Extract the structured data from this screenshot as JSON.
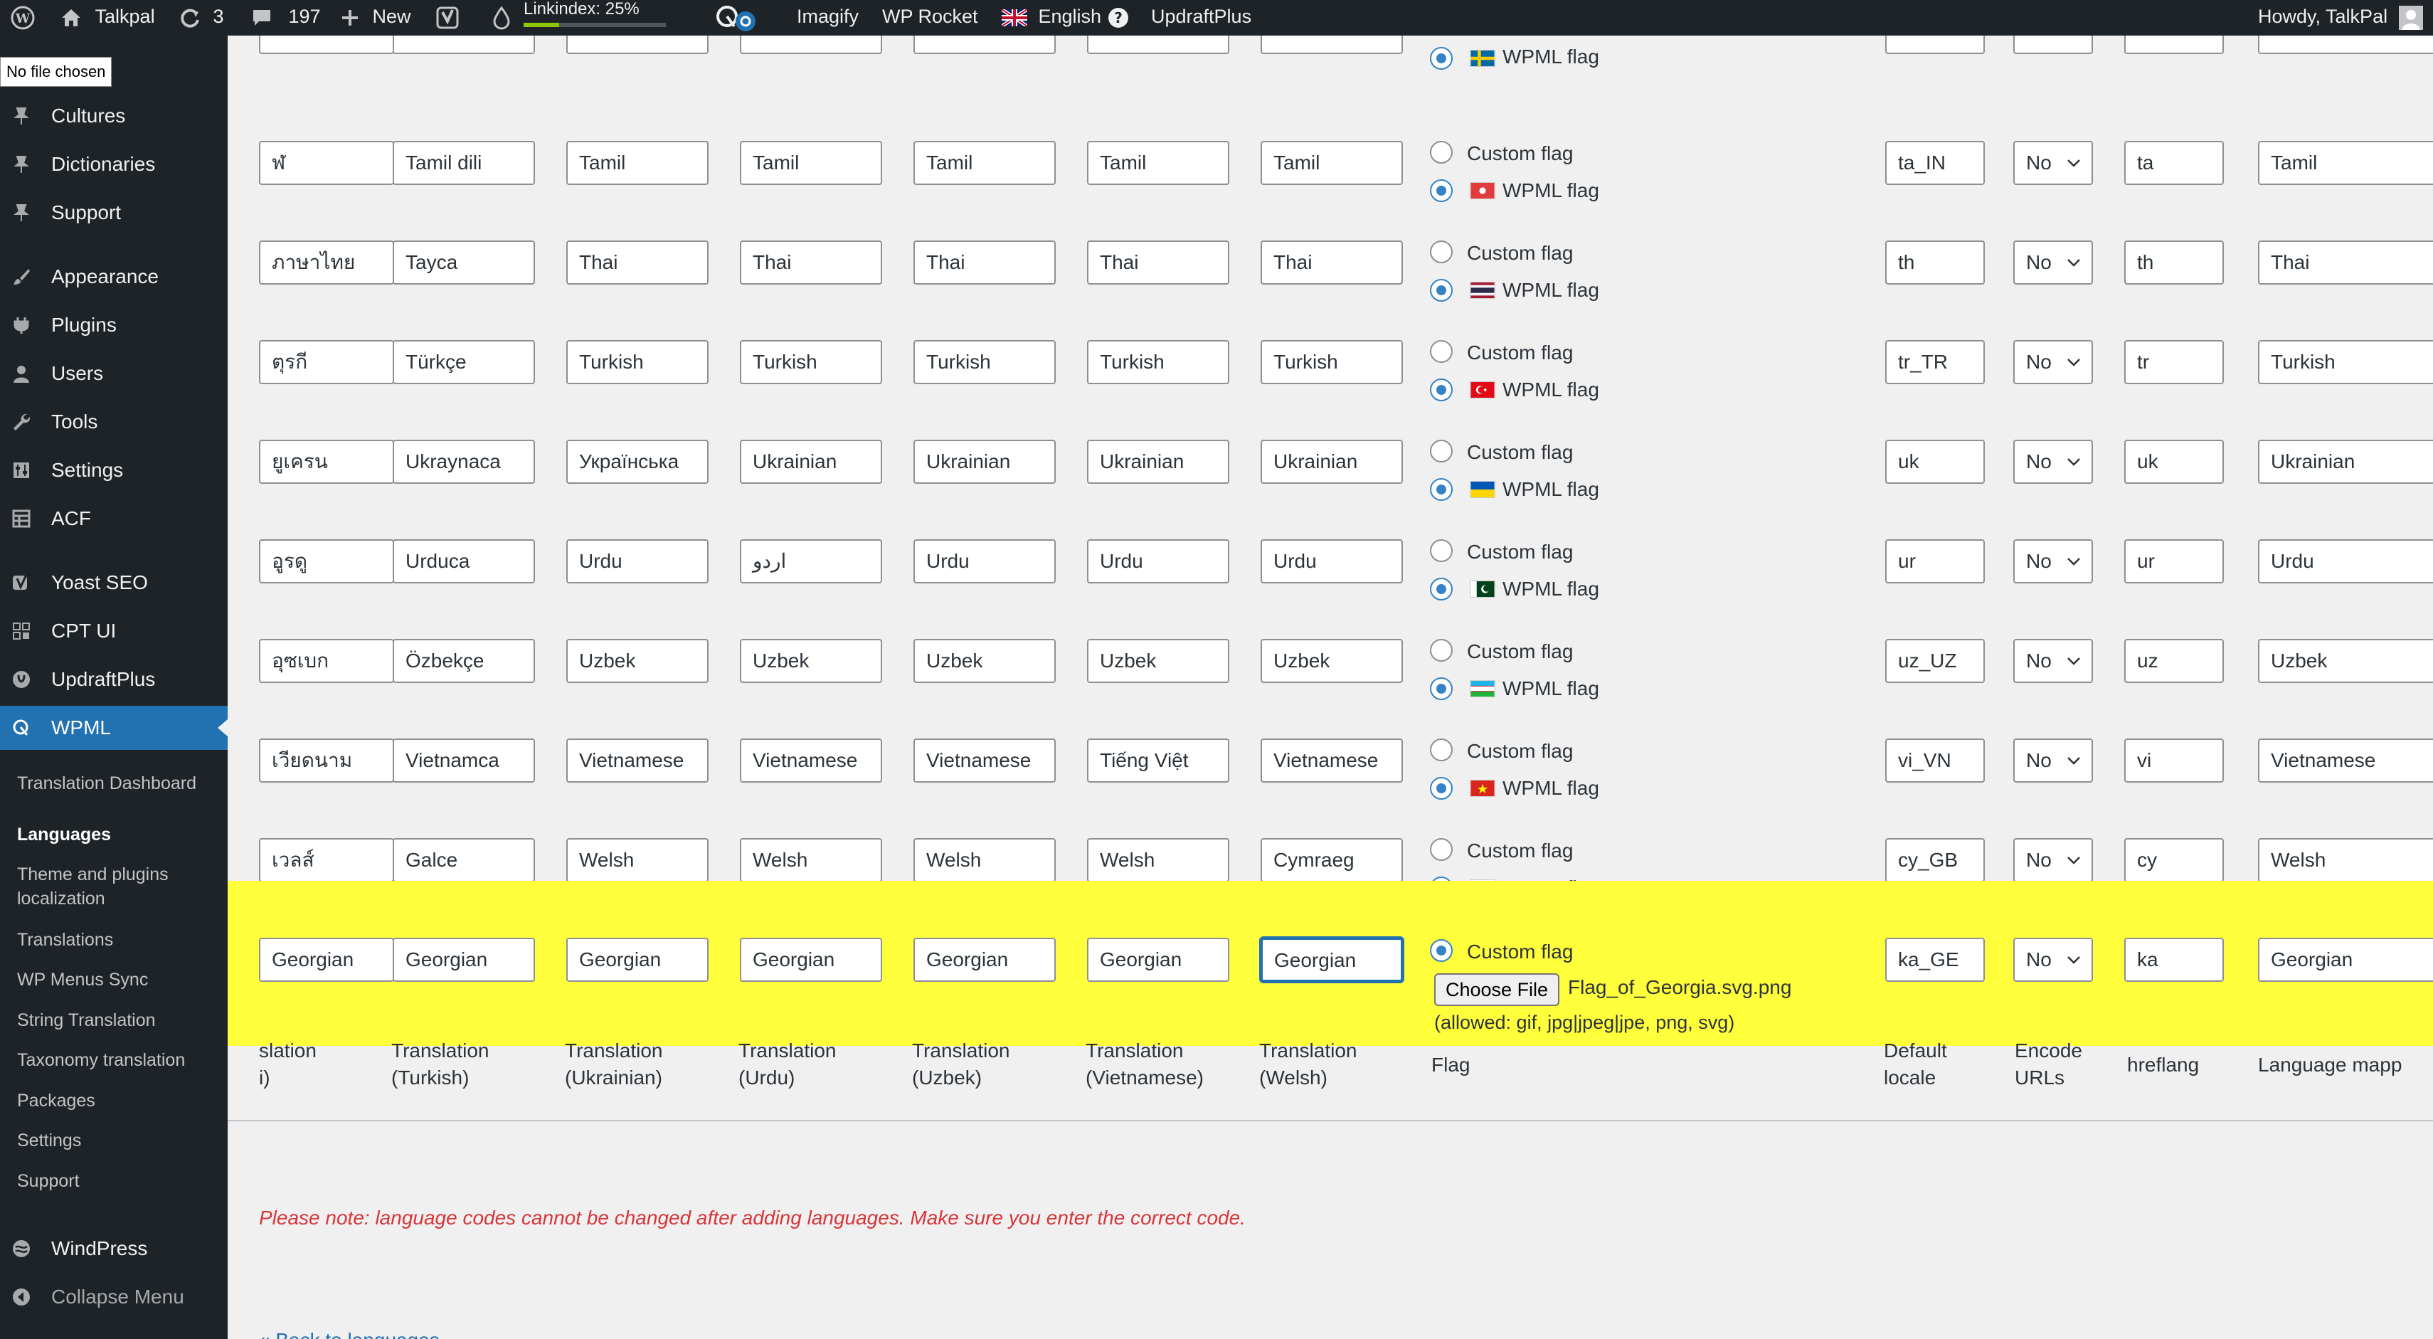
{
  "admin_bar": {
    "site_name": "Talkpal",
    "updates_count": "3",
    "comments_count": "197",
    "new_label": "New",
    "linkindex_label": "Linkindex: 25%",
    "linkindex_progress": 0.25,
    "imagify_label": "Imagify",
    "wp_rocket_label": "WP Rocket",
    "language_label": "English",
    "updraftplus_label": "UpdraftPlus",
    "howdy_label": "Howdy, TalkPal"
  },
  "tooltip": "No file chosen",
  "sidebar": {
    "items": [
      {
        "label": "Cultures",
        "icon": "pin-icon"
      },
      {
        "label": "Dictionaries",
        "icon": "pin-icon"
      },
      {
        "label": "Support",
        "icon": "pin-icon"
      },
      {
        "label": "Appearance",
        "icon": "brush-icon"
      },
      {
        "label": "Plugins",
        "icon": "plug-icon"
      },
      {
        "label": "Users",
        "icon": "user-icon"
      },
      {
        "label": "Tools",
        "icon": "wrench-icon"
      },
      {
        "label": "Settings",
        "icon": "sliders-icon"
      },
      {
        "label": "ACF",
        "icon": "grid-icon"
      },
      {
        "label": "Yoast SEO",
        "icon": "yoast-icon"
      },
      {
        "label": "CPT UI",
        "icon": "grid-icon"
      },
      {
        "label": "UpdraftPlus",
        "icon": "updraft-icon"
      },
      {
        "label": "WPML",
        "icon": "wpml-icon"
      }
    ],
    "submenu": [
      {
        "label": "Translation Dashboard"
      },
      {
        "label": "Languages"
      },
      {
        "label": "Theme and plugins localization"
      },
      {
        "label": "Translations"
      },
      {
        "label": "WP Menus Sync"
      },
      {
        "label": "String Translation"
      },
      {
        "label": "Taxonomy translation"
      },
      {
        "label": "Packages"
      },
      {
        "label": "Settings"
      },
      {
        "label": "Support"
      }
    ],
    "bottom_items": [
      {
        "label": "WindPress",
        "icon": "windpress-icon"
      },
      {
        "label": "Collapse Menu",
        "icon": "collapse-icon"
      }
    ]
  },
  "languages": {
    "top_partial_flag_label": "WPML flag",
    "rows": [
      {
        "c0": "ฬ",
        "c1": "Tamil dili",
        "c2": "Tamil",
        "c3": "Tamil",
        "c4": "Tamil",
        "c5": "Tamil",
        "c6": "Tamil",
        "custom_flag": "Custom flag",
        "wpml_flag": "WPML flag",
        "locale": "ta_IN",
        "encode": "No",
        "hreflang": "ta",
        "mapping": "Tamil"
      },
      {
        "c0": "ภาษาไทย",
        "c1": "Tayca",
        "c2": "Thai",
        "c3": "Thai",
        "c4": "Thai",
        "c5": "Thai",
        "c6": "Thai",
        "custom_flag": "Custom flag",
        "wpml_flag": "WPML flag",
        "locale": "th",
        "encode": "No",
        "hreflang": "th",
        "mapping": "Thai"
      },
      {
        "c0": "ตุรกี",
        "c1": "Türkçe",
        "c2": "Turkish",
        "c3": "Turkish",
        "c4": "Turkish",
        "c5": "Turkish",
        "c6": "Turkish",
        "custom_flag": "Custom flag",
        "wpml_flag": "WPML flag",
        "locale": "tr_TR",
        "encode": "No",
        "hreflang": "tr",
        "mapping": "Turkish"
      },
      {
        "c0": "ยูเครน",
        "c1": "Ukraynaca",
        "c2": "Українська",
        "c3": "Ukrainian",
        "c4": "Ukrainian",
        "c5": "Ukrainian",
        "c6": "Ukrainian",
        "custom_flag": "Custom flag",
        "wpml_flag": "WPML flag",
        "locale": "uk",
        "encode": "No",
        "hreflang": "uk",
        "mapping": "Ukrainian"
      },
      {
        "c0": "อูรดู",
        "c1": "Urduca",
        "c2": "Urdu",
        "c3": "اردو",
        "c4": "Urdu",
        "c5": "Urdu",
        "c6": "Urdu",
        "custom_flag": "Custom flag",
        "wpml_flag": "WPML flag",
        "locale": "ur",
        "encode": "No",
        "hreflang": "ur",
        "mapping": "Urdu"
      },
      {
        "c0": "อุซเบก",
        "c1": "Özbekçe",
        "c2": "Uzbek",
        "c3": "Uzbek",
        "c4": "Uzbek",
        "c5": "Uzbek",
        "c6": "Uzbek",
        "custom_flag": "Custom flag",
        "wpml_flag": "WPML flag",
        "locale": "uz_UZ",
        "encode": "No",
        "hreflang": "uz",
        "mapping": "Uzbek"
      },
      {
        "c0": "เวียดนาม",
        "c1": "Vietnamca",
        "c2": "Vietnamese",
        "c3": "Vietnamese",
        "c4": "Vietnamese",
        "c5": "Tiếng Việt",
        "c6": "Vietnamese",
        "custom_flag": "Custom flag",
        "wpml_flag": "WPML flag",
        "locale": "vi_VN",
        "encode": "No",
        "hreflang": "vi",
        "mapping": "Vietnamese"
      },
      {
        "c0": "เวลส์",
        "c1": "Galce",
        "c2": "Welsh",
        "c3": "Welsh",
        "c4": "Welsh",
        "c5": "Welsh",
        "c6": "Cymraeg",
        "custom_flag": "Custom flag",
        "wpml_flag": "WPML flag",
        "locale": "cy_GB",
        "encode": "No",
        "hreflang": "cy",
        "mapping": "Welsh"
      }
    ],
    "new_row": {
      "c0": "Georgian",
      "c1": "Georgian",
      "c2": "Georgian",
      "c3": "Georgian",
      "c4": "Georgian",
      "c5": "Georgian",
      "c6": "Georgian",
      "custom_flag": "Custom flag",
      "choose_file": "Choose File",
      "file_name": "Flag_of_Georgia.svg.png",
      "allowed": "(allowed: gif, jpg|jpeg|jpe, png, svg)",
      "locale": "ka_GE",
      "encode": "No",
      "hreflang": "ka",
      "mapping": "Georgian"
    },
    "headers": {
      "c0a": "slation",
      "c0b": "i)",
      "c1a": "Translation",
      "c1b": "(Turkish)",
      "c2a": "Translation",
      "c2b": "(Ukrainian)",
      "c3a": "Translation",
      "c3b": "(Urdu)",
      "c4a": "Translation",
      "c4b": "(Uzbek)",
      "c5a": "Translation",
      "c5b": "(Vietnamese)",
      "c6a": "Translation",
      "c6b": "(Welsh)",
      "flag": "Flag",
      "locale_a": "Default",
      "locale_b": "locale",
      "encode_a": "Encode",
      "encode_b": "URLs",
      "hreflang": "hreflang",
      "mapping": "Language mapp"
    },
    "note": "Please note: language codes cannot be changed after adding languages. Make sure you enter the correct code.",
    "back_link": "« Back to languages"
  },
  "colors": {
    "admin_bar_bg": "#1d2327",
    "sidebar_bg": "#1d2327",
    "active_menu": "#2271b1",
    "highlight_row": "#ffff3c",
    "note_red": "#d63638",
    "link_blue": "#2271b1"
  }
}
